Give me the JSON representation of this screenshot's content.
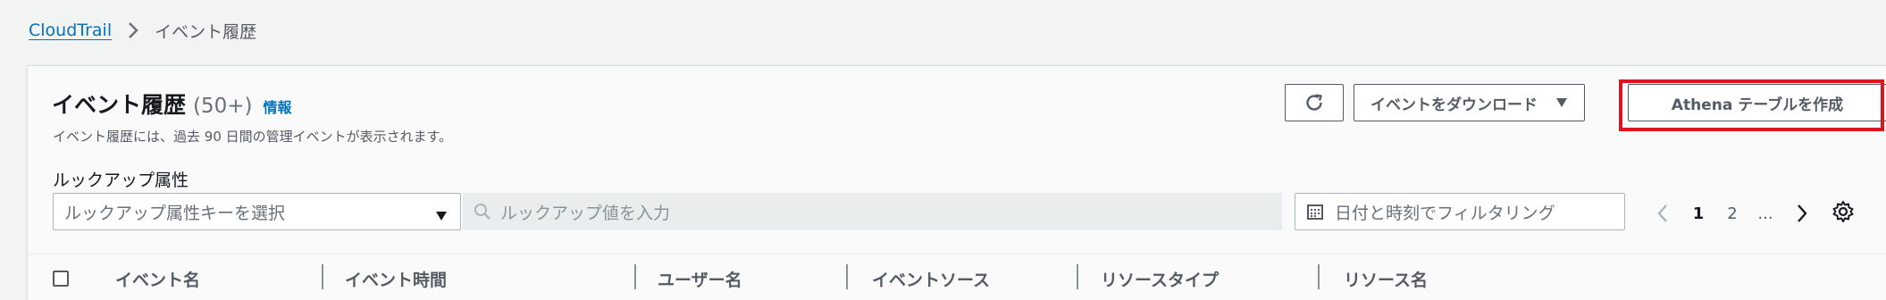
{
  "breadcrumb": {
    "root": "CloudTrail",
    "current": "イベント履歴"
  },
  "header": {
    "title": "イベント履歴",
    "count": "(50+)",
    "info_link": "情報",
    "description": "イベント履歴には、過去 90 日間の管理イベントが表示されます。"
  },
  "actions": {
    "refresh_icon": "refresh-icon",
    "download_label": "イベントをダウンロード",
    "athena_label": "Athena テーブルを作成"
  },
  "lookup": {
    "label": "ルックアップ属性",
    "select_placeholder": "ルックアップ属性キーを選択",
    "search_placeholder": "ルックアップ値を入力",
    "date_placeholder": "日付と時刻でフィルタリング"
  },
  "pagination": {
    "pages": [
      "1",
      "2",
      "..."
    ],
    "current": "1"
  },
  "table": {
    "columns": [
      "イベント名",
      "イベント時間",
      "ユーザー名",
      "イベントソース",
      "リソースタイプ",
      "リソース名"
    ]
  },
  "colors": {
    "link": "#0073bb",
    "highlight": "#e0141e",
    "text_secondary": "#545b64"
  }
}
